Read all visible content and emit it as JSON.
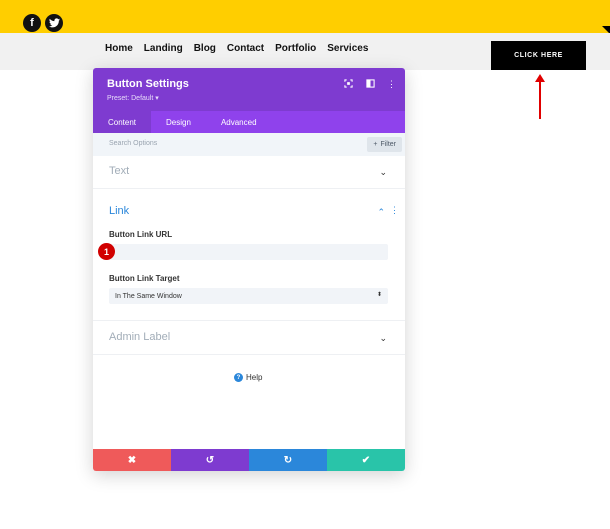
{
  "site": {
    "social": [
      {
        "name": "facebook",
        "glyph": "f"
      },
      {
        "name": "twitter",
        "glyph": "t"
      }
    ],
    "nav": [
      "Home",
      "Landing",
      "Blog",
      "Contact",
      "Portfolio",
      "Services"
    ],
    "cta_label": "CLICK HERE",
    "colors": {
      "topbar": "#ffce00",
      "navbar": "#f1f1f1",
      "cta": "#000000",
      "annotation": "#e00000"
    }
  },
  "modal": {
    "title": "Button Settings",
    "preset": "Preset: Default ▾",
    "header_icons": [
      "expand-icon",
      "columns-icon",
      "more-vertical-icon"
    ],
    "tabs": [
      "Content",
      "Design",
      "Advanced"
    ],
    "active_tab": "Content",
    "search_placeholder": "Search Options",
    "filter_label": "Filter",
    "sections": {
      "text": "Text",
      "link": "Link",
      "admin": "Admin Label"
    },
    "fields": {
      "url_label": "Button Link URL",
      "url_value": "",
      "target_label": "Button Link Target",
      "target_value": "In The Same Window"
    },
    "badge_number": "1",
    "help_label": "Help",
    "colors": {
      "header": "#7e3bd0",
      "tabs": "#8f42ec",
      "link_accent": "#2b87da",
      "cancel": "#ef5a5a",
      "undo": "#7e3bd0",
      "redo": "#2b87da",
      "save": "#29c4a9"
    }
  }
}
